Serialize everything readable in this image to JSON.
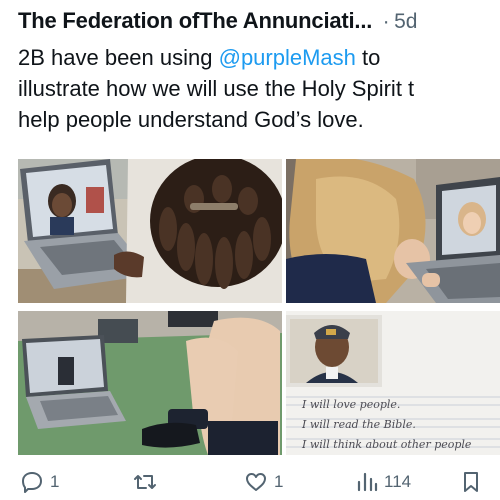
{
  "tweet": {
    "author": "The Federation ofThe Annunciati...",
    "separator": "·",
    "time": "5d",
    "text": {
      "line1_prefix": "2B have been using ",
      "mention": "@purpleMash",
      "line1_suffix": " to",
      "line2": "illustrate how we will use the Holy Spirit t",
      "line3": "help people understand God’s love."
    }
  },
  "media": {
    "photos": [
      "girl-with-laptop-photo",
      "girl-blonde-laptop-photo",
      "laptop-on-floor-photo",
      "handwriting-worksheet-photo"
    ],
    "worksheet_lines": [
      "I will love people.",
      "I will read the Bible.",
      "I will think about other people"
    ]
  },
  "actions": {
    "reply_count": "1",
    "retweet_count": "",
    "like_count": "1",
    "views_count": "114"
  },
  "icons": [
    "reply-icon",
    "retweet-icon",
    "like-icon",
    "views-icon",
    "bookmark-icon"
  ],
  "colors": {
    "link": "#1d9bf0",
    "muted": "#536471",
    "text": "#0f1419"
  }
}
